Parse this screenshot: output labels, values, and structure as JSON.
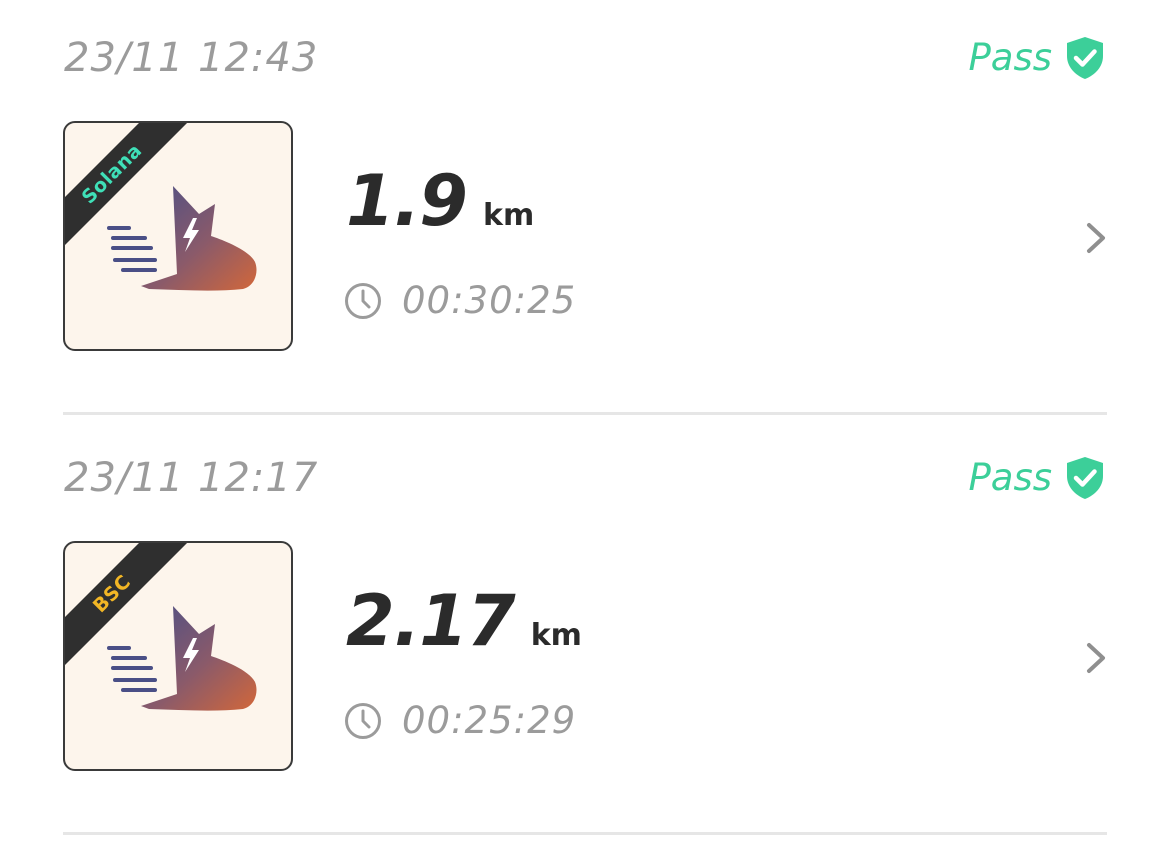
{
  "colors": {
    "pass": "#3ccf99",
    "solana_label": "#3fe0b8",
    "bsc_label": "#f2b625",
    "muted_text": "#9b9b9b",
    "value_text": "#2b2b2b"
  },
  "runs": [
    {
      "timestamp": "23/11 12:43",
      "status": "Pass",
      "status_icon": "shield-check-icon",
      "network": "Solana",
      "distance": "1.9",
      "unit": "km",
      "duration": "00:30:25"
    },
    {
      "timestamp": "23/11 12:17",
      "status": "Pass",
      "status_icon": "shield-check-icon",
      "network": "BSC",
      "distance": "2.17",
      "unit": "km",
      "duration": "00:25:29"
    }
  ]
}
